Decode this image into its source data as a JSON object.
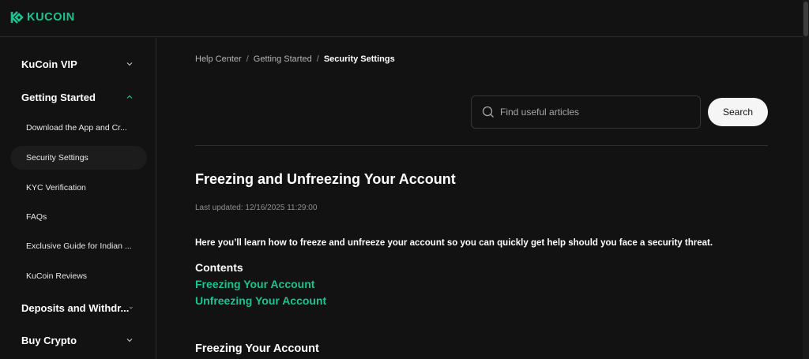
{
  "brand": {
    "name": "KUCOIN",
    "accent": "#1dc28f"
  },
  "sidebar": {
    "groups": [
      {
        "label": "KuCoin VIP",
        "expanded": false
      },
      {
        "label": "Getting Started",
        "expanded": true
      },
      {
        "label": "Deposits and Withdr...",
        "expanded": false
      },
      {
        "label": "Buy Crypto",
        "expanded": false
      }
    ],
    "items": [
      {
        "label": "Download the App and Cr..."
      },
      {
        "label": "Security Settings",
        "active": true
      },
      {
        "label": "KYC Verification"
      },
      {
        "label": "FAQs"
      },
      {
        "label": "Exclusive Guide for Indian ..."
      },
      {
        "label": "KuCoin Reviews"
      }
    ]
  },
  "breadcrumb": {
    "items": [
      "Help Center",
      "Getting Started"
    ],
    "separator": "/",
    "current": "Security Settings"
  },
  "search": {
    "placeholder": "Find useful articles",
    "value": "",
    "button_label": "Search"
  },
  "article": {
    "title": "Freezing and Unfreezing Your Account",
    "updated": "Last updated: 12/16/2025 11:29:00",
    "intro": "Here you’ll learn how to freeze and unfreeze your account so you can quickly get help should you face a security threat.",
    "contents_heading": "Contents",
    "toc": [
      "Freezing Your Account",
      "Unfreezing Your Account"
    ],
    "section_heading": "Freezing Your Account"
  },
  "icons": {
    "logo": "kucoin-logo-icon",
    "search": "search-icon",
    "chevron_down": "chevron-down-icon",
    "chevron_up": "chevron-up-icon"
  }
}
